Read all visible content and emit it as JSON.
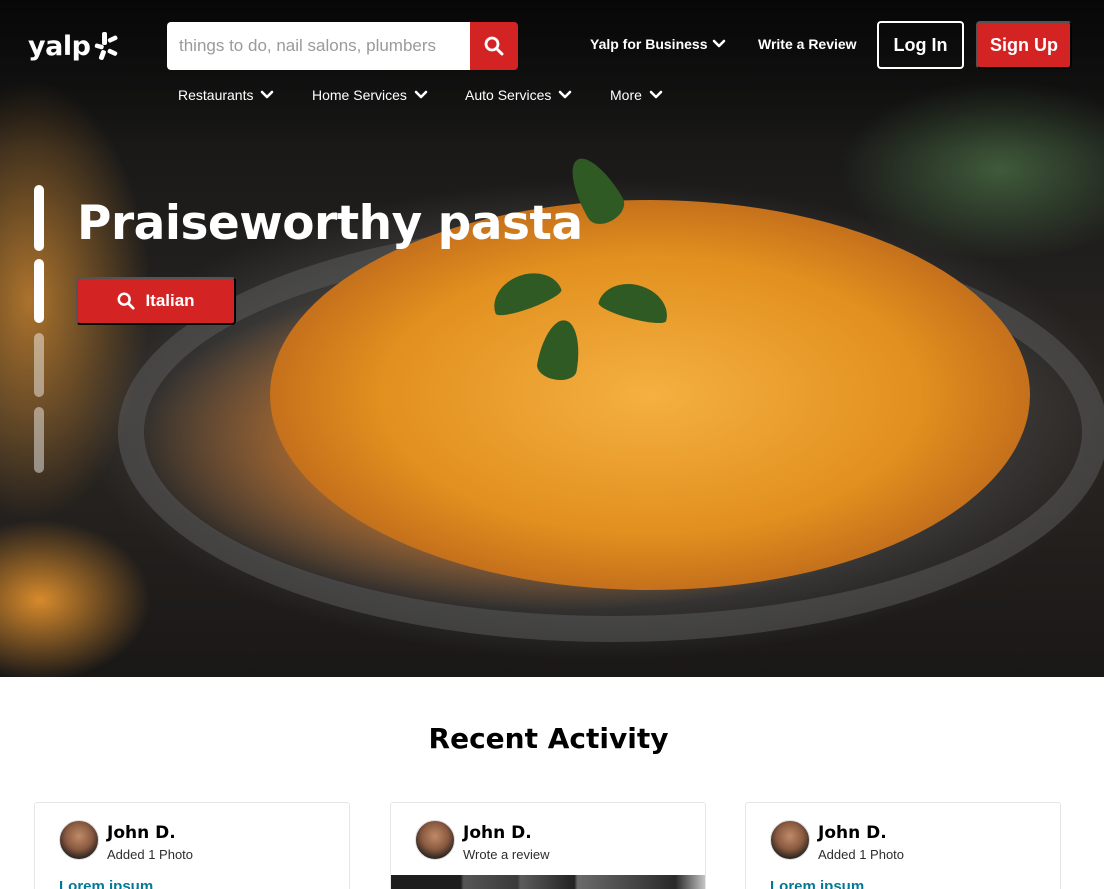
{
  "header": {
    "logo_text": "yalp",
    "search_placeholder": "things to do, nail salons, plumbers",
    "links": {
      "business": "Yalp for Business",
      "write_review": "Write a Review"
    },
    "login_label": "Log In",
    "signup_label": "Sign Up"
  },
  "nav": {
    "items": [
      {
        "label": "Restaurants"
      },
      {
        "label": "Home Services"
      },
      {
        "label": "Auto Services"
      },
      {
        "label": "More"
      }
    ]
  },
  "hero": {
    "title": "Praiseworthy pasta",
    "cta_label": "Italian",
    "slides_total": 4,
    "slides_active": 2
  },
  "recent_activity": {
    "title": "Recent Activity",
    "cards": [
      {
        "user": "John D.",
        "action": "Added 1 Photo",
        "link": "Lorem ipsum"
      },
      {
        "user": "John D.",
        "action": "Wrote a review"
      },
      {
        "user": "John D.",
        "action": "Added 1 Photo",
        "link": "Lorem ipsum"
      }
    ]
  },
  "colors": {
    "brand_red": "#d32323",
    "link_teal": "#027a97"
  },
  "icons": [
    "burst-logo-icon",
    "search-icon",
    "chevron-down-icon"
  ]
}
